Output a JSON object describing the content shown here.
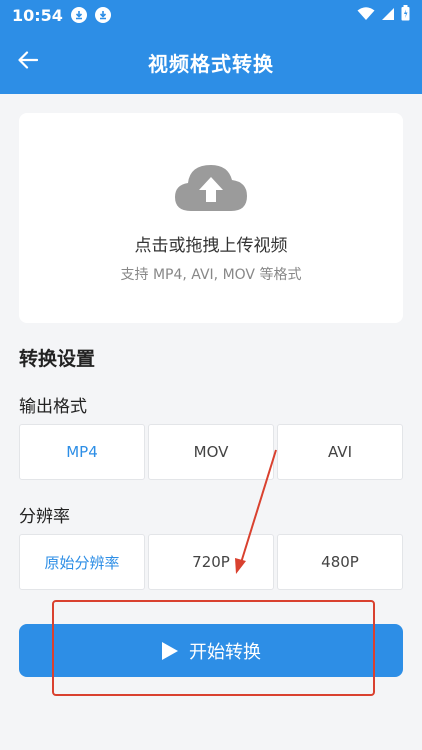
{
  "status_bar": {
    "time": "10:54",
    "icons": [
      "download-icon",
      "download-icon",
      "wifi-icon",
      "signal-icon",
      "battery-icon"
    ]
  },
  "app_bar": {
    "title": "视频格式转换",
    "back_icon": "arrow-left-icon",
    "color": "#2d8ee6"
  },
  "upload": {
    "icon": "cloud-upload-icon",
    "primary_text": "点击或拖拽上传视频",
    "secondary_text": "支持 MP4, AVI, MOV 等格式"
  },
  "settings": {
    "title": "转换设置",
    "output_format": {
      "label": "输出格式",
      "options": [
        "MP4",
        "MOV",
        "AVI"
      ],
      "selected": "MP4"
    },
    "resolution": {
      "label": "分辨率",
      "options": [
        "原始分辨率",
        "720P",
        "480P"
      ],
      "selected": "原始分辨率"
    }
  },
  "start_button": {
    "label": "开始转换",
    "icon": "play-icon"
  },
  "annotation_color": "#d9412f"
}
